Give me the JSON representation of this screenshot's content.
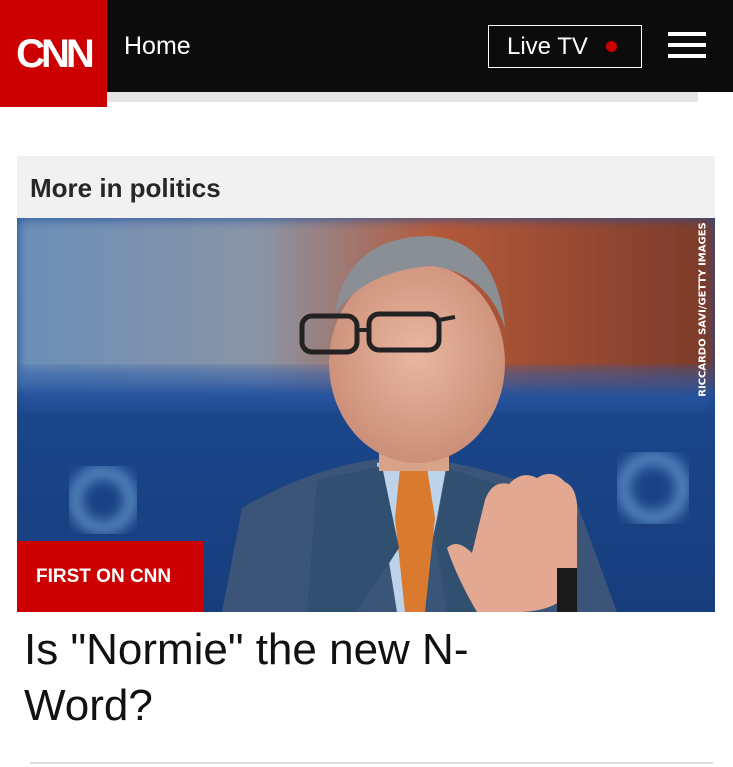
{
  "header": {
    "logo": "CNN",
    "nav_label": "Home",
    "live_tv_label": "Live TV",
    "live_indicator_color": "#cc0000",
    "menu_icon": "hamburger-menu-icon"
  },
  "section": {
    "title": "More in politics"
  },
  "story": {
    "kicker": "FIRST ON CNN",
    "photo_credit": "RICCARDO SAVI/GETTY IMAGES",
    "headline": "Is \"Normie\" the new N-Word?"
  },
  "colors": {
    "brand_red": "#cc0000",
    "header_bg": "#0c0c0c"
  }
}
